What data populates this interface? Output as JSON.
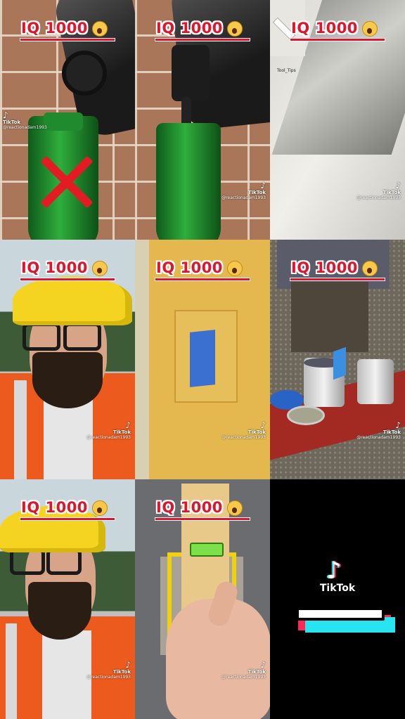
{
  "caption": "IQ 1000",
  "emoji": "scream-emoji",
  "watermark": {
    "brand": "TikTok",
    "user": "@reactionadam1993",
    "logo": "♪"
  },
  "panels": [
    {
      "scene": "oil-jug-over-bottle-with-x"
    },
    {
      "scene": "oil-pouring-into-bottle"
    },
    {
      "scene": "wall-corner-tool-tips",
      "label": "Tool_Tips"
    },
    {
      "scene": "man-in-hardhat-talking"
    },
    {
      "scene": "yellow-wall-blue-patch"
    },
    {
      "scene": "paint-cans-on-bench"
    },
    {
      "scene": "man-in-hardhat-talking-2"
    },
    {
      "scene": "level-on-wood-in-wall"
    },
    {
      "scene": "tiktok-end-card"
    }
  ],
  "endcard": {
    "logo": "♪",
    "brand": "TikTok"
  }
}
